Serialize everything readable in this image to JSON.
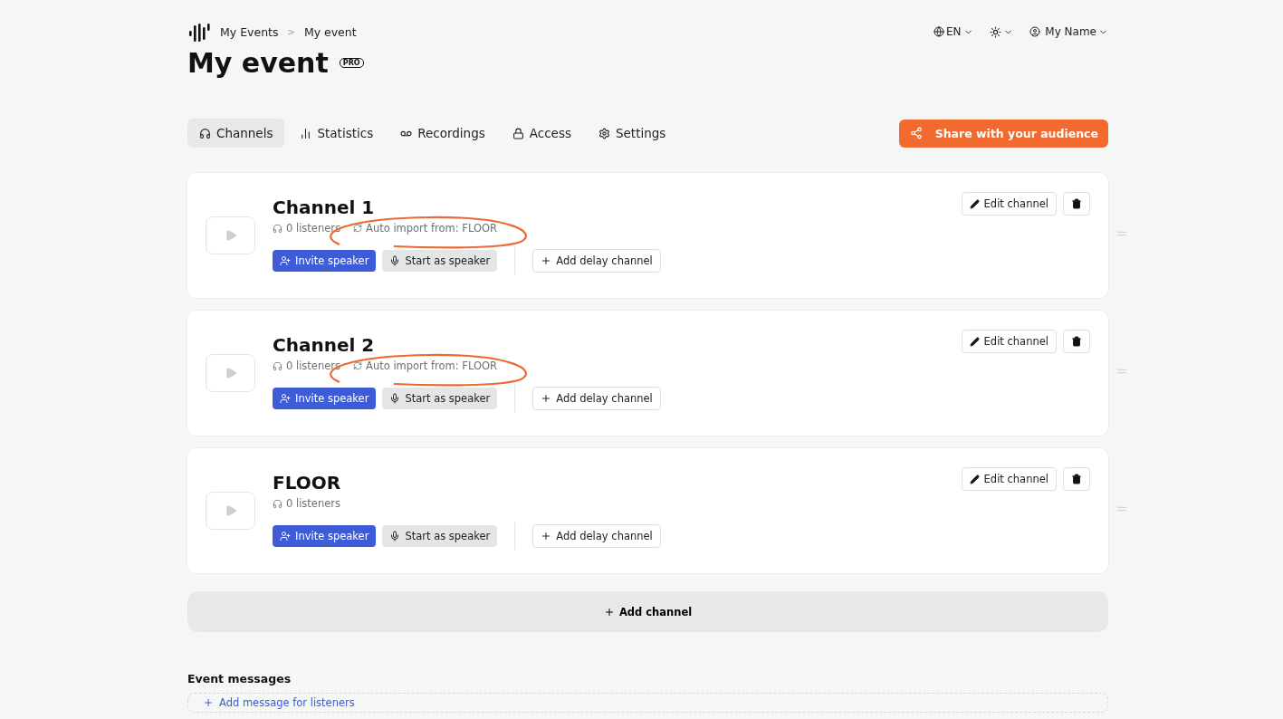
{
  "breadcrumb": [
    "My Events",
    "My event"
  ],
  "breadcrumb_separator": ">",
  "header_menu": {
    "language": "EN",
    "user": "My Name"
  },
  "title": "My event",
  "badge": "PRO",
  "tabs": [
    {
      "label": "Channels",
      "selected": true
    },
    {
      "label": "Statistics",
      "selected": false
    },
    {
      "label": "Recordings",
      "selected": false
    },
    {
      "label": "Access",
      "selected": false
    },
    {
      "label": "Settings",
      "selected": false
    }
  ],
  "share_button": "Share with your audience",
  "channels": [
    {
      "name": "Channel 1",
      "listeners": "0 listeners",
      "auto_import": "Auto import from: FLOOR",
      "highlighted": true,
      "invite": "Invite speaker",
      "start": "Start as speaker",
      "add_delay": "Add delay channel",
      "edit": "Edit channel"
    },
    {
      "name": "Channel 2",
      "listeners": "0 listeners",
      "auto_import": "Auto import from: FLOOR",
      "highlighted": true,
      "invite": "Invite speaker",
      "start": "Start as speaker",
      "add_delay": "Add delay channel",
      "edit": "Edit channel"
    },
    {
      "name": "FLOOR",
      "listeners": "0 listeners",
      "highlighted": false,
      "invite": "Invite speaker",
      "start": "Start as speaker",
      "add_delay": "Add delay channel",
      "edit": "Edit channel"
    }
  ],
  "add_channel": "Add channel",
  "event_messages": {
    "heading": "Event messages",
    "add_message": "Add message for listeners"
  }
}
